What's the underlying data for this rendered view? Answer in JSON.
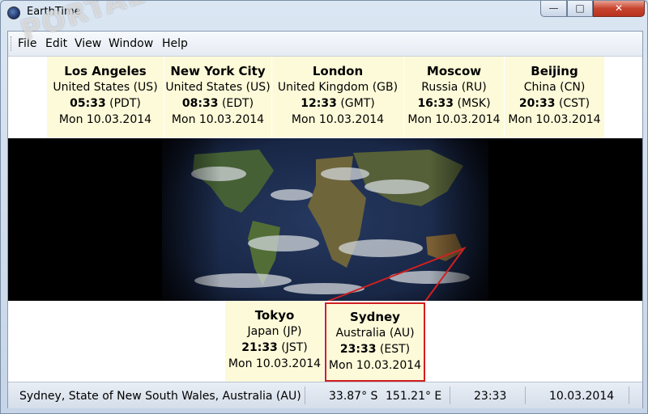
{
  "window": {
    "title": "EarthTime"
  },
  "controls": {
    "minimize": "—",
    "maximize": "□",
    "close": "✕"
  },
  "menu": [
    "File",
    "Edit",
    "View",
    "Window",
    "Help"
  ],
  "watermark": "PORTAL",
  "top_cities": [
    {
      "name": "Los Angeles",
      "country": "United States (US)",
      "time": "05:33",
      "tz": "(PDT)",
      "date": "Mon 10.03.2014"
    },
    {
      "name": "New York City",
      "country": "United States (US)",
      "time": "08:33",
      "tz": "(EDT)",
      "date": "Mon 10.03.2014"
    },
    {
      "name": "London",
      "country": "United Kingdom (GB)",
      "time": "12:33",
      "tz": "(GMT)",
      "date": "Mon 10.03.2014"
    },
    {
      "name": "Moscow",
      "country": "Russia (RU)",
      "time": "16:33",
      "tz": "(MSK)",
      "date": "Mon 10.03.2014"
    },
    {
      "name": "Beijing",
      "country": "China (CN)",
      "time": "20:33",
      "tz": "(CST)",
      "date": "Mon 10.03.2014"
    }
  ],
  "bottom_cities": [
    {
      "name": "Tokyo",
      "country": "Japan (JP)",
      "time": "21:33",
      "tz": "(JST)",
      "date": "Mon 10.03.2014"
    },
    {
      "name": "Sydney",
      "country": "Australia (AU)",
      "time": "23:33",
      "tz": "(EST)",
      "date": "Mon 10.03.2014"
    }
  ],
  "status": {
    "location": "Sydney, State of New South Wales, Australia (AU)",
    "latitude": "33.87° S",
    "longitude": "151.21° E",
    "time": "23:33",
    "date": "10.03.2014"
  },
  "colors": {
    "selected_border": "#d02020",
    "card_bg": "#fdfad9"
  }
}
